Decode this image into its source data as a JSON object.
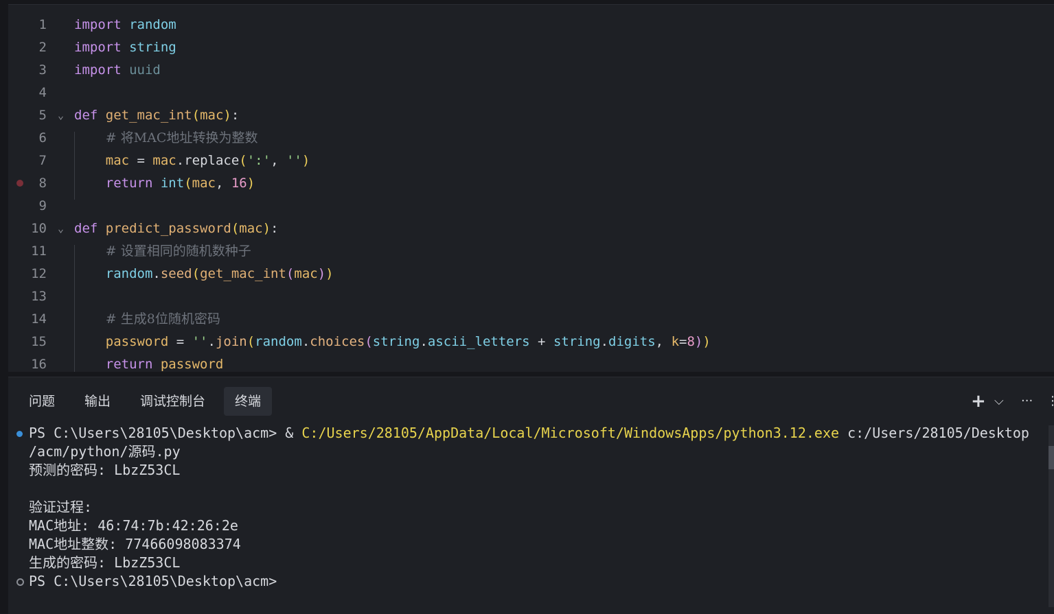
{
  "editor": {
    "language": "python",
    "lines": [
      {
        "n": "1",
        "segments": [
          {
            "t": "import",
            "c": "kw"
          },
          {
            "t": " "
          },
          {
            "t": "random",
            "c": "mod"
          }
        ]
      },
      {
        "n": "2",
        "segments": [
          {
            "t": "import",
            "c": "kw"
          },
          {
            "t": " "
          },
          {
            "t": "string",
            "c": "mod"
          }
        ]
      },
      {
        "n": "3",
        "segments": [
          {
            "t": "import",
            "c": "kw"
          },
          {
            "t": " "
          },
          {
            "t": "uuid",
            "c": "mod-dim"
          }
        ]
      },
      {
        "n": "4",
        "segments": []
      },
      {
        "n": "5",
        "fold": true,
        "segments": [
          {
            "t": "def",
            "c": "kw"
          },
          {
            "t": " "
          },
          {
            "t": "get_mac_int",
            "c": "fn"
          },
          {
            "t": "(",
            "c": "br1"
          },
          {
            "t": "mac",
            "c": "var"
          },
          {
            "t": ")",
            "c": "br1"
          },
          {
            "t": ":",
            "c": "op"
          }
        ]
      },
      {
        "n": "6",
        "indent": true,
        "segments": [
          {
            "t": "    "
          },
          {
            "t": "# 将MAC地址转换为整数",
            "c": "cmt"
          }
        ]
      },
      {
        "n": "7",
        "indent": true,
        "segments": [
          {
            "t": "    "
          },
          {
            "t": "mac",
            "c": "var"
          },
          {
            "t": " = ",
            "c": "op"
          },
          {
            "t": "mac",
            "c": "var"
          },
          {
            "t": ".",
            "c": "op"
          },
          {
            "t": "replace",
            "c": "op"
          },
          {
            "t": "(",
            "c": "br1"
          },
          {
            "t": "':'",
            "c": "str"
          },
          {
            "t": ", ",
            "c": "op"
          },
          {
            "t": "''",
            "c": "str"
          },
          {
            "t": ")",
            "c": "br1"
          }
        ]
      },
      {
        "n": "8",
        "breakpoint": true,
        "indent": true,
        "segments": [
          {
            "t": "    "
          },
          {
            "t": "return",
            "c": "kw"
          },
          {
            "t": " "
          },
          {
            "t": "int",
            "c": "mod"
          },
          {
            "t": "(",
            "c": "br1"
          },
          {
            "t": "mac",
            "c": "var"
          },
          {
            "t": ", ",
            "c": "op"
          },
          {
            "t": "16",
            "c": "num"
          },
          {
            "t": ")",
            "c": "br1"
          }
        ]
      },
      {
        "n": "9",
        "segments": []
      },
      {
        "n": "10",
        "fold": true,
        "segments": [
          {
            "t": "def",
            "c": "kw"
          },
          {
            "t": " "
          },
          {
            "t": "predict_password",
            "c": "fn"
          },
          {
            "t": "(",
            "c": "br1"
          },
          {
            "t": "mac",
            "c": "var"
          },
          {
            "t": ")",
            "c": "br1"
          },
          {
            "t": ":",
            "c": "op"
          }
        ]
      },
      {
        "n": "11",
        "indent": true,
        "segments": [
          {
            "t": "    "
          },
          {
            "t": "# 设置相同的随机数种子",
            "c": "cmt"
          }
        ]
      },
      {
        "n": "12",
        "indent": true,
        "segments": [
          {
            "t": "    "
          },
          {
            "t": "random",
            "c": "mod"
          },
          {
            "t": ".",
            "c": "op"
          },
          {
            "t": "seed",
            "c": "mth"
          },
          {
            "t": "(",
            "c": "br1"
          },
          {
            "t": "get_mac_int",
            "c": "fn"
          },
          {
            "t": "(",
            "c": "br2"
          },
          {
            "t": "mac",
            "c": "var"
          },
          {
            "t": ")",
            "c": "br2"
          },
          {
            "t": ")",
            "c": "br1"
          }
        ]
      },
      {
        "n": "13",
        "indent": true,
        "segments": []
      },
      {
        "n": "14",
        "indent": true,
        "segments": [
          {
            "t": "    "
          },
          {
            "t": "# 生成8位随机密码",
            "c": "cmt"
          }
        ]
      },
      {
        "n": "15",
        "indent": true,
        "segments": [
          {
            "t": "    "
          },
          {
            "t": "password",
            "c": "var"
          },
          {
            "t": " = ",
            "c": "op"
          },
          {
            "t": "''",
            "c": "str"
          },
          {
            "t": ".",
            "c": "op"
          },
          {
            "t": "join",
            "c": "mth"
          },
          {
            "t": "(",
            "c": "br1"
          },
          {
            "t": "random",
            "c": "mod"
          },
          {
            "t": ".",
            "c": "op"
          },
          {
            "t": "choices",
            "c": "mth"
          },
          {
            "t": "(",
            "c": "br2"
          },
          {
            "t": "string",
            "c": "mod"
          },
          {
            "t": ".",
            "c": "op"
          },
          {
            "t": "ascii_letters",
            "c": "mod"
          },
          {
            "t": " + ",
            "c": "op"
          },
          {
            "t": "string",
            "c": "mod"
          },
          {
            "t": ".",
            "c": "op"
          },
          {
            "t": "digits",
            "c": "mod"
          },
          {
            "t": ", ",
            "c": "op"
          },
          {
            "t": "k",
            "c": "var"
          },
          {
            "t": "=",
            "c": "op"
          },
          {
            "t": "8",
            "c": "num"
          },
          {
            "t": ")",
            "c": "br2"
          },
          {
            "t": ")",
            "c": "br1"
          }
        ]
      },
      {
        "n": "16",
        "indent": true,
        "segments": [
          {
            "t": "    "
          },
          {
            "t": "return",
            "c": "kw"
          },
          {
            "t": " "
          },
          {
            "t": "password",
            "c": "var"
          }
        ]
      }
    ]
  },
  "panel": {
    "tabs": [
      {
        "label": "问题",
        "active": false
      },
      {
        "label": "输出",
        "active": false
      },
      {
        "label": "调试控制台",
        "active": false
      },
      {
        "label": "终端",
        "active": true
      }
    ],
    "tools": {
      "add": "+",
      "dropdown": "⌵",
      "more": "···",
      "extra": "⋮"
    },
    "terminal": {
      "cmd_prompt": "PS C:\\Users\\28105\\Desktop\\acm> & ",
      "cmd_path": "C:/Users/28105/AppData/Local/Microsoft/WindowsApps/python3.12.exe",
      "cmd_arg": " c:/Users/28105/Desktop",
      "cmd_arg_cont": "/acm/python/源码.py",
      "out1": "预测的密码: LbzZ53CL",
      "out2": "",
      "out3": "验证过程:",
      "out4": "MAC地址: 46:74:7b:42:26:2e",
      "out5": "MAC地址整数: 77466098083374",
      "out6": "生成的密码: LbzZ53CL",
      "final_prompt": "PS C:\\Users\\28105\\Desktop\\acm>"
    }
  },
  "colors": {
    "background": "#1e2025",
    "keyword": "#c792ea",
    "module": "#7fd0e6",
    "string": "#9ad28a",
    "number": "#e99dc9",
    "path": "#e8d44d"
  }
}
